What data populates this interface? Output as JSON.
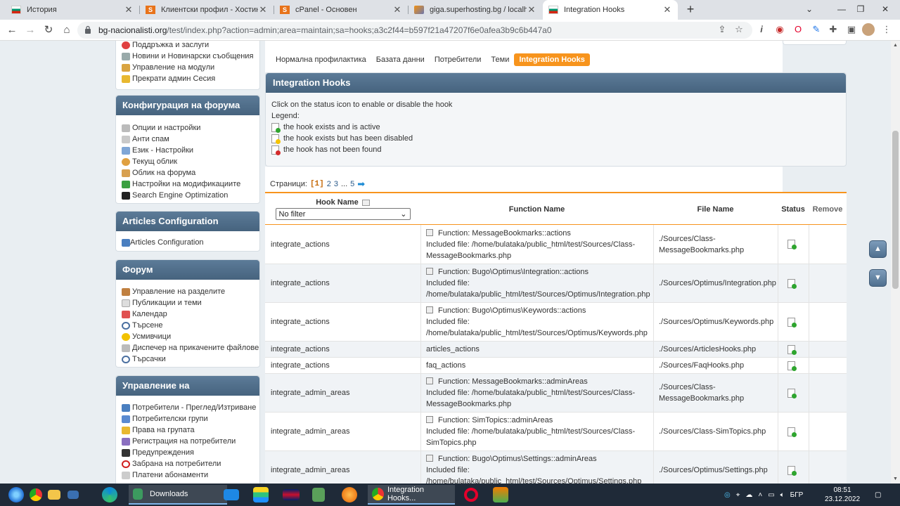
{
  "browser": {
    "tabs": [
      {
        "title": "История",
        "icon": "bulgaria-flag-icon",
        "active": false
      },
      {
        "title": "Клиентски профил - Хостинг ак",
        "icon": "superhosting-icon",
        "active": false
      },
      {
        "title": "cPanel - Основен",
        "icon": "cpanel-icon",
        "active": false
      },
      {
        "title": "giga.superhosting.bg / localhost",
        "icon": "phpmyadmin-icon",
        "active": false
      },
      {
        "title": "Integration Hooks",
        "icon": "bulgaria-flag-icon",
        "active": true
      }
    ],
    "url_host": "bg-nacionalisti.org",
    "url_path": "/test/index.php?action=admin;area=maintain;sa=hooks;a3c2f44=b597f21a47207f6e0afea3b9c6b447a0"
  },
  "sidebar": {
    "maintenance_items": [
      {
        "label": "Поддръжка и заслуги",
        "icon": "lifebuoy-icon"
      },
      {
        "label": "Новини и Новинарски съобщения",
        "icon": "news-icon"
      },
      {
        "label": "Управление на модули",
        "icon": "package-icon"
      },
      {
        "label": "Прекрати админ Сесия",
        "icon": "key-icon"
      }
    ],
    "sections": [
      {
        "title": "Конфигурация на форума",
        "items": [
          {
            "label": "Опции и настройки",
            "icon": "options-icon"
          },
          {
            "label": "Анти спам",
            "icon": "spam-icon"
          },
          {
            "label": "Език - Настройки",
            "icon": "language-icon"
          },
          {
            "label": "Текущ облик",
            "icon": "palette-icon"
          },
          {
            "label": "Облик на форума",
            "icon": "theme-icon"
          },
          {
            "label": "Настройки на модификациите",
            "icon": "puzzle-icon"
          },
          {
            "label": "Search Engine Optimization",
            "icon": "seo-icon"
          }
        ]
      },
      {
        "title": "Articles Configuration",
        "items": [
          {
            "label": "Articles Configuration",
            "icon": "book-icon"
          }
        ]
      },
      {
        "title": "Форум",
        "items": [
          {
            "label": "Управление на разделите",
            "icon": "boards-icon"
          },
          {
            "label": "Публикации и теми",
            "icon": "posts-icon"
          },
          {
            "label": "Календар",
            "icon": "calendar-icon"
          },
          {
            "label": "Търсене",
            "icon": "search-icon"
          },
          {
            "label": "Усмивчици",
            "icon": "smiley-icon"
          },
          {
            "label": "Диспечер на прикачените файлове",
            "icon": "attachment-icon"
          },
          {
            "label": "Търсачки",
            "icon": "search-engines-icon"
          }
        ]
      },
      {
        "title": "Управление на потребителите",
        "items": [
          {
            "label": "Потребители - Преглед/Изтриване",
            "icon": "user-icon"
          },
          {
            "label": "Потребителски групи",
            "icon": "group-icon"
          },
          {
            "label": "Права на групата",
            "icon": "permissions-icon"
          },
          {
            "label": "Регистрация на потребители",
            "icon": "register-icon"
          },
          {
            "label": "Предупреждения",
            "icon": "warning-icon"
          },
          {
            "label": "Забрана на потребители",
            "icon": "ban-icon"
          },
          {
            "label": "Платени абонаменти",
            "icon": "subscription-icon"
          }
        ]
      }
    ]
  },
  "subtabs": [
    {
      "label": "Нормална профилактика",
      "active": false
    },
    {
      "label": "Базата данни",
      "active": false
    },
    {
      "label": "Потребители",
      "active": false
    },
    {
      "label": "Теми",
      "active": false
    },
    {
      "label": "Integration Hooks",
      "active": true
    }
  ],
  "hooks_panel": {
    "title": "Integration Hooks",
    "instruction": "Click on the status icon to enable or disable the hook",
    "legend_label": "Legend:",
    "legend": [
      {
        "text": "the hook exists and is active",
        "status": "active"
      },
      {
        "text": "the hook exists but has been disabled",
        "status": "disabled"
      },
      {
        "text": "the hook has not been found",
        "status": "missing"
      }
    ]
  },
  "pager": {
    "label": "Страници:",
    "current": "[1]",
    "pages": [
      "2",
      "3"
    ],
    "ellipsis": "...",
    "last": "5"
  },
  "table": {
    "columns": {
      "hook_name": "Hook Name",
      "function_name": "Function Name",
      "file_name": "File Name",
      "status": "Status",
      "remove": "Remove"
    },
    "filter_value": "No filter",
    "rows": [
      {
        "hook": "integrate_actions",
        "fn_line1": "Function: MessageBookmarks::actions",
        "fn_line2": "Included file: /home/bulataka/public_html/test/Sources/Class-",
        "fn_line3": "MessageBookmarks.php",
        "file_line1": "./Sources/Class-",
        "file_line2": "MessageBookmarks.php",
        "status": "active"
      },
      {
        "hook": "integrate_actions",
        "fn_line1": "Function: Bugo\\Optimus\\Integration::actions",
        "fn_line2": "Included file:",
        "fn_line3": "/home/bulataka/public_html/test/Sources/Optimus/Integration.php",
        "file_line1": "./Sources/Optimus/Integration.php",
        "file_line2": "",
        "status": "active"
      },
      {
        "hook": "integrate_actions",
        "fn_line1": "Function: Bugo\\Optimus\\Keywords::actions",
        "fn_line2": "Included file:",
        "fn_line3": "/home/bulataka/public_html/test/Sources/Optimus/Keywords.php",
        "file_line1": "./Sources/Optimus/Keywords.php",
        "file_line2": "",
        "status": "active"
      },
      {
        "hook": "integrate_actions",
        "fn_line1": "articles_actions",
        "fn_line2": "",
        "fn_line3": "",
        "file_line1": "./Sources/ArticlesHooks.php",
        "file_line2": "",
        "status": "active"
      },
      {
        "hook": "integrate_actions",
        "fn_line1": "faq_actions",
        "fn_line2": "",
        "fn_line3": "",
        "file_line1": "./Sources/FaqHooks.php",
        "file_line2": "",
        "status": "active"
      },
      {
        "hook": "integrate_admin_areas",
        "fn_line1": "Function: MessageBookmarks::adminAreas",
        "fn_line2": "Included file: /home/bulataka/public_html/test/Sources/Class-",
        "fn_line3": "MessageBookmarks.php",
        "file_line1": "./Sources/Class-",
        "file_line2": "MessageBookmarks.php",
        "status": "active"
      },
      {
        "hook": "integrate_admin_areas",
        "fn_line1": "Function: SimTopics::adminAreas",
        "fn_line2": "Included file: /home/bulataka/public_html/test/Sources/Class-",
        "fn_line3": "SimTopics.php",
        "file_line1": "./Sources/Class-SimTopics.php",
        "file_line2": "",
        "status": "active"
      },
      {
        "hook": "integrate_admin_areas",
        "fn_line1": "Function: Bugo\\Optimus\\Settings::adminAreas",
        "fn_line2": "Included file:",
        "fn_line3": "/home/bulataka/public_html/test/Sources/Optimus/Settings.php",
        "file_line1": "./Sources/Optimus/Settings.php",
        "file_line2": "",
        "status": "active"
      }
    ]
  },
  "taskbar": {
    "downloads_label": "Downloads",
    "active_app_label": "Integration Hooks...",
    "language": "БГР",
    "time": "08:51",
    "date": "23.12.2022 г."
  },
  "colors": {
    "accent_orange": "#f7941d",
    "header_blue": "#4f6f8a",
    "status_active": "#2ea52e"
  }
}
